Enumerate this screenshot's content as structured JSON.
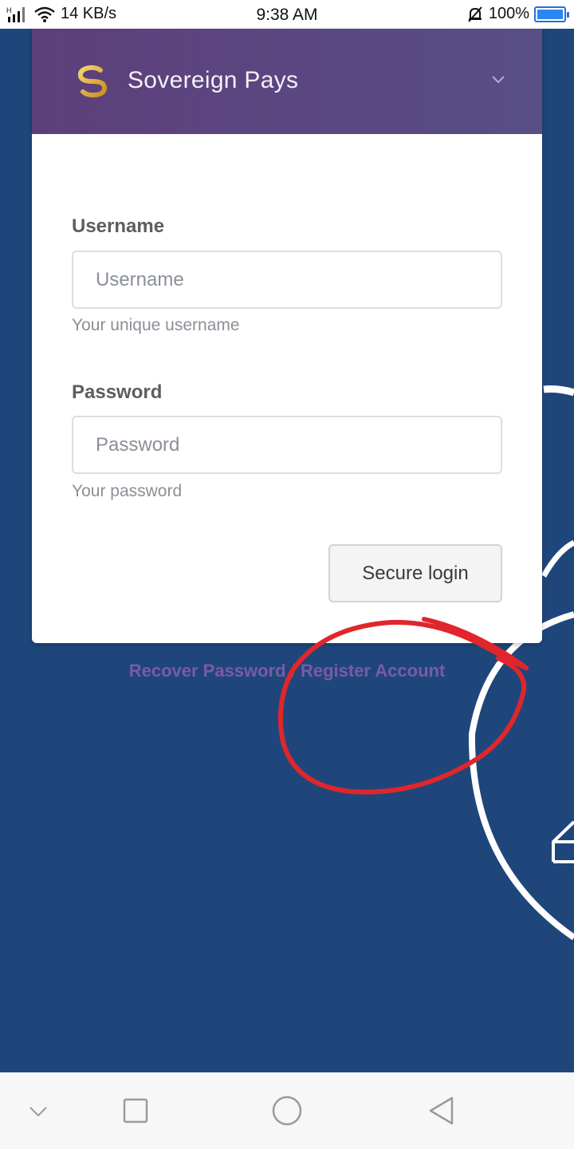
{
  "status_bar": {
    "network_speed": "14 KB/s",
    "time": "9:38 AM",
    "battery_percent": "100%",
    "signal_icon": "signal-icon",
    "wifi_icon": "wifi-icon",
    "mute_icon": "bell-off-icon",
    "battery_level": 1.0
  },
  "header": {
    "brand_name": "Sovereign Pays",
    "logo_icon": "sovereign-pays-logo-icon",
    "menu_icon": "chevron-down-icon",
    "gradient_start": "#5d3f7b",
    "gradient_end": "#584e86"
  },
  "form": {
    "username": {
      "label": "Username",
      "placeholder": "Username",
      "value": "",
      "help_text": "Your unique username"
    },
    "password": {
      "label": "Password",
      "placeholder": "Password",
      "value": "",
      "help_text": "Your password"
    },
    "submit_label": "Secure login"
  },
  "links": {
    "recover_password": "Recover Password",
    "separator": "/",
    "register_account": "Register Account",
    "color": "#7b5aa6"
  },
  "colors": {
    "background": "#1f467a",
    "annotation": "#e0262c"
  },
  "nav_bar": {
    "icons": [
      "chevron-down-icon",
      "recent-apps-icon",
      "home-icon",
      "back-icon"
    ]
  }
}
